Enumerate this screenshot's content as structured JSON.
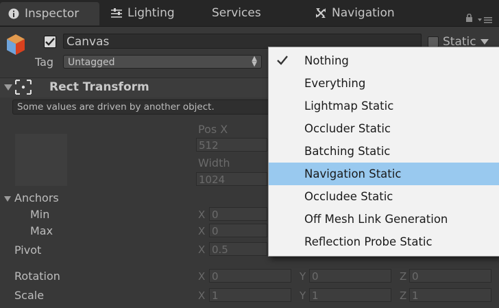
{
  "tabs": [
    {
      "label": "Inspector",
      "icon": "info-icon",
      "active": true
    },
    {
      "label": "Lighting",
      "icon": "sliders-icon",
      "active": false
    },
    {
      "label": "Services",
      "icon": "",
      "active": false
    },
    {
      "label": "Navigation",
      "icon": "navigation-icon",
      "active": false
    }
  ],
  "gameobject": {
    "name": "Canvas",
    "active_checked": true,
    "static_label": "Static",
    "tag_label": "Tag",
    "tag_value": "Untagged"
  },
  "rect_transform": {
    "title": "Rect Transform",
    "notice": "Some values are driven by another object.",
    "pos_x_label": "Pos X",
    "pos_x_value": "512",
    "width_label": "Width",
    "width_value": "1024",
    "anchors_label": "Anchors",
    "min_label": "Min",
    "max_label": "Max",
    "pivot_label": "Pivot",
    "rotation_label": "Rotation",
    "scale_label": "Scale",
    "anchor_min_x": "0",
    "anchor_max_x": "0",
    "pivot_x": "0.5",
    "rotation": {
      "x": "0",
      "y": "0",
      "z": "0"
    },
    "scale": {
      "x": "1",
      "y": "1",
      "z": "1"
    },
    "axis_labels": {
      "x": "X",
      "y": "Y",
      "z": "Z"
    }
  },
  "static_menu": {
    "items": [
      {
        "label": "Nothing",
        "checked": true,
        "highlighted": false
      },
      {
        "label": "Everything",
        "checked": false,
        "highlighted": false
      },
      {
        "label": "Lightmap Static",
        "checked": false,
        "highlighted": false
      },
      {
        "label": "Occluder Static",
        "checked": false,
        "highlighted": false
      },
      {
        "label": "Batching Static",
        "checked": false,
        "highlighted": false
      },
      {
        "label": "Navigation Static",
        "checked": false,
        "highlighted": true
      },
      {
        "label": "Occludee Static",
        "checked": false,
        "highlighted": false
      },
      {
        "label": "Off Mesh Link Generation",
        "checked": false,
        "highlighted": false
      },
      {
        "label": "Reflection Probe Static",
        "checked": false,
        "highlighted": false
      }
    ]
  },
  "colors": {
    "background": "#383838",
    "menu_highlight": "#99c9ef",
    "menu_background": "#f2f2f2"
  }
}
